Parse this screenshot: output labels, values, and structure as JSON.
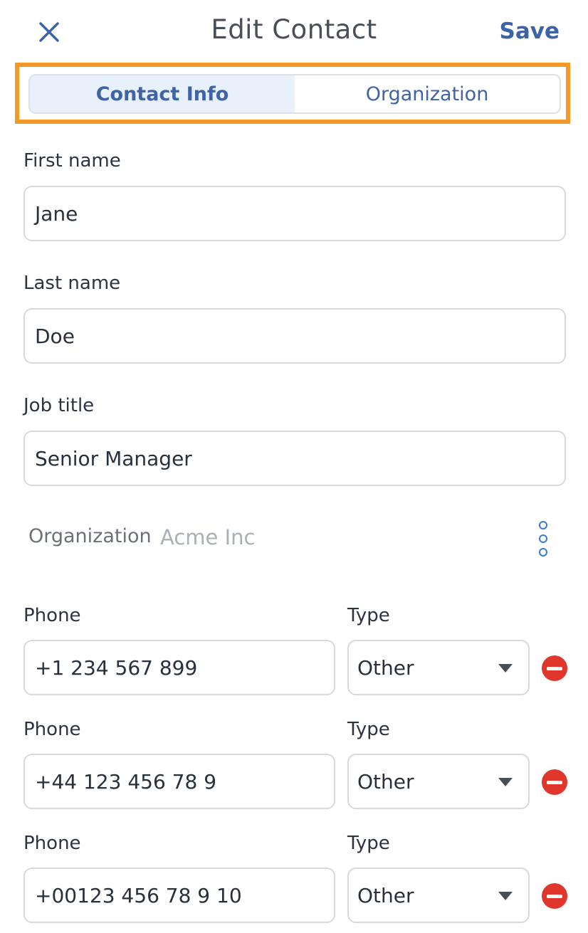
{
  "header": {
    "title": "Edit Contact",
    "save_label": "Save",
    "close_icon": "close-icon"
  },
  "tabs": [
    {
      "label": "Contact Info",
      "active": true
    },
    {
      "label": "Organization",
      "active": false
    }
  ],
  "form": {
    "first_name": {
      "label": "First name",
      "value": "Jane"
    },
    "last_name": {
      "label": "Last name",
      "value": "Doe"
    },
    "job_title": {
      "label": "Job title",
      "value": "Senior Manager"
    },
    "organization": {
      "label": "Organization",
      "value": "Acme Inc"
    },
    "phones": [
      {
        "label": "Phone",
        "type_label": "Type",
        "value": "+1 234 567 899",
        "type": "Other"
      },
      {
        "label": "Phone",
        "type_label": "Type",
        "value": "+44 123 456 78 9",
        "type": "Other"
      },
      {
        "label": "Phone",
        "type_label": "Type",
        "value": "+00123 456 78 9 10",
        "type": "Other"
      }
    ]
  },
  "colors": {
    "accent": "#3b64a8",
    "highlight": "#f29a25",
    "remove": "#e0362b"
  }
}
